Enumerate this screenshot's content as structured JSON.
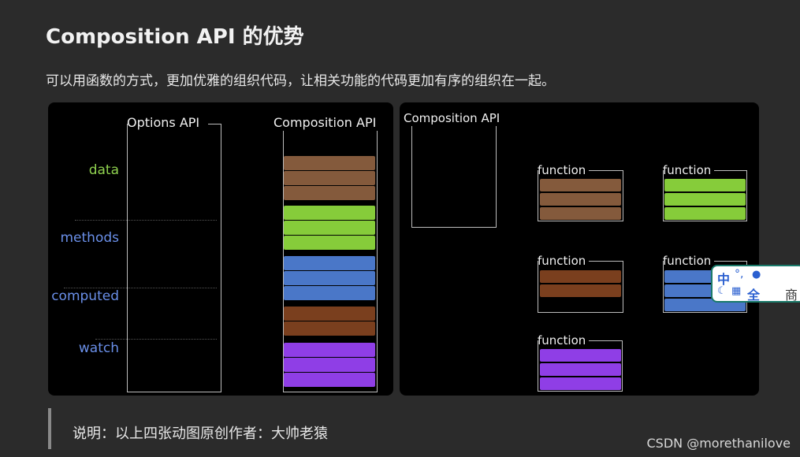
{
  "page": {
    "title": "Composition API 的优势",
    "intro": "可以用函数的方式，更加优雅的组织代码，让相关功能的代码更加有序的组织在一起。",
    "note": "说明：以上四张动图原创作者：大帅老猿",
    "watermark": "CSDN @morethanilove"
  },
  "left_figure": {
    "options_label": "Options API",
    "composition_label": "Composition API",
    "rows": [
      {
        "label": "data",
        "color": "#8fd14f"
      },
      {
        "label": "methods",
        "color": "#6a8fe8"
      },
      {
        "label": "computed",
        "color": "#6a8fe8"
      },
      {
        "label": "watch",
        "color": "#6a8fe8"
      }
    ]
  },
  "right_figure": {
    "composition_label": "Composition API",
    "function_label": "function"
  },
  "colors": {
    "brown": "#845a3c",
    "dark_brown": "#7a3f1e",
    "green": "#86cc3a",
    "blue": "#4a77c8",
    "purple": "#8f3ee6"
  },
  "ime": {
    "top_left": "中",
    "top_mid": "°,",
    "bottom_full": "全",
    "right_text": "商"
  }
}
